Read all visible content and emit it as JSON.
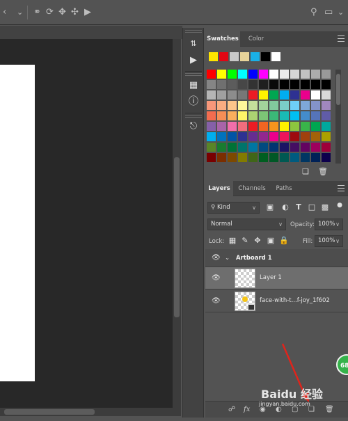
{
  "swatches_panel": {
    "tabs": [
      "Swatches",
      "Color"
    ],
    "recent_colors": [
      "#ffe400",
      "#e20613",
      "#c8c8c8",
      "#e8d49a",
      "#1ab0e6",
      "#000000",
      "#ffffff"
    ],
    "grid": [
      [
        "#ff0000",
        "#ffff00",
        "#00ff00",
        "#00ffff",
        "#0000ff",
        "#ff00ff",
        "#ffffff",
        "#ebebeb",
        "#d6d6d6",
        "#c2c2c2",
        "#adadad",
        "#999999"
      ],
      [
        "#858585",
        "#707070",
        "#5c5c5c",
        "#474747",
        "#333333",
        "#1f1f1f",
        "#0a0a0a",
        "#000000",
        "#000000",
        "#000000",
        "#000000",
        "#000000"
      ],
      [
        "#b5b5b5",
        "#a0a0a0",
        "#8c8c8c",
        "#777777",
        "#ec1c24",
        "#fff200",
        "#00a651",
        "#00aeef",
        "#2e3192",
        "#ec008c",
        "#ffffff",
        "#d9d9d9"
      ],
      [
        "#f7977a",
        "#f9ad81",
        "#fdc68a",
        "#fff79a",
        "#c4df9b",
        "#a3d39c",
        "#82ca9d",
        "#7bcdc8",
        "#6ecff6",
        "#7ea7d8",
        "#8493ca",
        "#a187be"
      ],
      [
        "#f26c4f",
        "#f68e56",
        "#fbaf5d",
        "#fff568",
        "#acd372",
        "#7cc576",
        "#3bb878",
        "#1abbb4",
        "#00bff3",
        "#448ccb",
        "#5574b9",
        "#605ca8"
      ],
      [
        "#8560a8",
        "#a864a8",
        "#f06eaa",
        "#f26d7d",
        "#ed1c24",
        "#f26522",
        "#f7941d",
        "#fff200",
        "#8dc63f",
        "#39b54a",
        "#00a651",
        "#00a99d"
      ],
      [
        "#00aeef",
        "#0072bc",
        "#0054a6",
        "#2e3192",
        "#662d91",
        "#92278f",
        "#ec008c",
        "#ed145b",
        "#9e0b0f",
        "#a0410d",
        "#a36209",
        "#aba000"
      ],
      [
        "#598527",
        "#197b30",
        "#007236",
        "#00746b",
        "#0076a3",
        "#004a80",
        "#003471",
        "#1b1464",
        "#440e62",
        "#630460",
        "#9e005d",
        "#9e0039"
      ],
      [
        "#790000",
        "#7b2e00",
        "#7d4900",
        "#827b00",
        "#406618",
        "#005e20",
        "#005826",
        "#005952",
        "#005b7f",
        "#003663",
        "#002157",
        "#0d004c"
      ]
    ]
  },
  "layers_panel": {
    "tabs": [
      "Layers",
      "Channels",
      "Paths"
    ],
    "filter_label": "Kind",
    "blend_mode": "Normal",
    "opacity_label": "Opacity:",
    "opacity_value": "100%",
    "lock_label": "Lock:",
    "fill_label": "Fill:",
    "fill_value": "100%",
    "artboard_name": "Artboard 1",
    "layers": [
      {
        "name": "Layer 1",
        "selected": true
      },
      {
        "name": "face-with-t...f-joy_1f602",
        "selected": false
      }
    ],
    "bottom_icons": [
      "link-icon",
      "fx-icon",
      "mask-icon",
      "adjustment-icon",
      "group-icon",
      "new-layer-icon",
      "trash-icon"
    ]
  },
  "badge_value": "68",
  "watermark": {
    "title": "Baidu 经验",
    "sub": "jingyan.baidu.com"
  }
}
